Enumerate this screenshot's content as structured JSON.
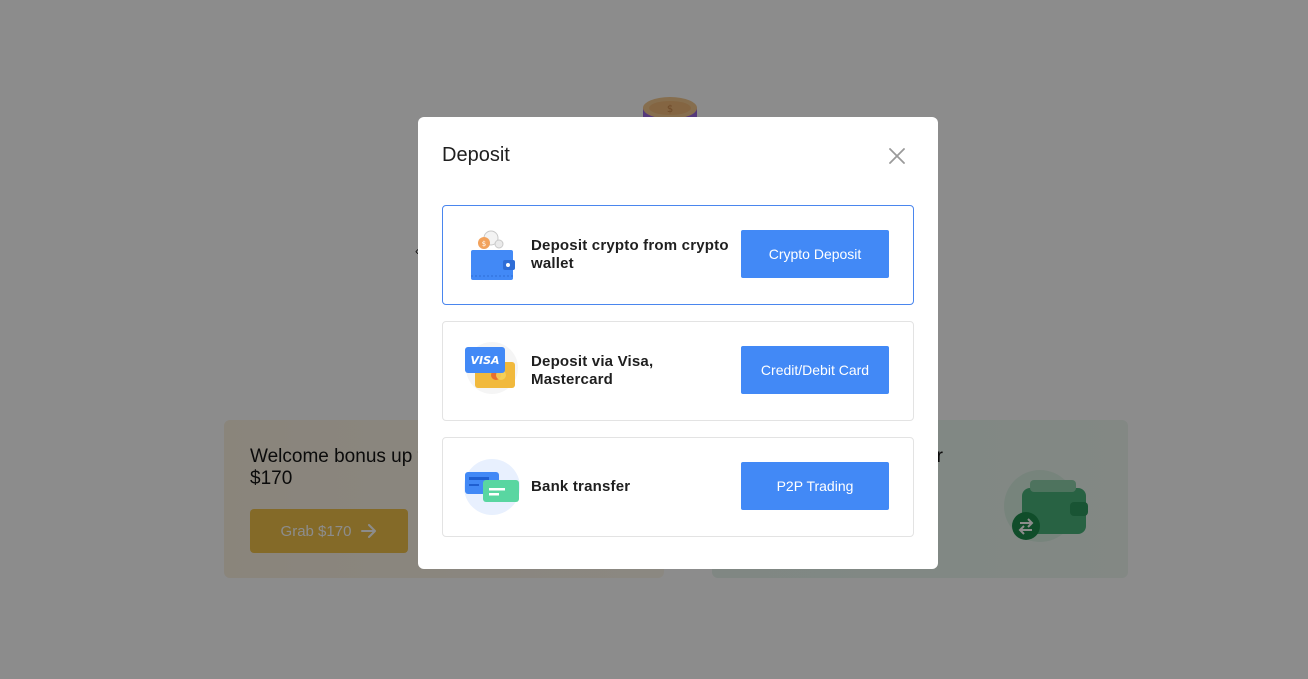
{
  "background": {
    "stray_text": "‹",
    "promo_left": {
      "title": "Welcome bonus up to $170",
      "button_label": "Grab $170"
    },
    "promo_right": {
      "title_tail": "r"
    }
  },
  "modal": {
    "title": "Deposit",
    "options": [
      {
        "label": "Deposit crypto from crypto wallet",
        "button": "Crypto Deposit",
        "icon": "crypto-wallet-icon",
        "selected": true
      },
      {
        "label": "Deposit via Visa, Mastercard",
        "button": "Credit/Debit Card",
        "icon": "visa-mastercard-icon",
        "selected": false
      },
      {
        "label": "Bank transfer",
        "button": "P2P Trading",
        "icon": "bank-card-icon",
        "selected": false
      }
    ]
  },
  "colors": {
    "accent": "#4289f6",
    "selected_border": "#4a86ee",
    "grab_button": "#f1c24a",
    "overlay": "rgba(0,0,0,0.45)"
  }
}
